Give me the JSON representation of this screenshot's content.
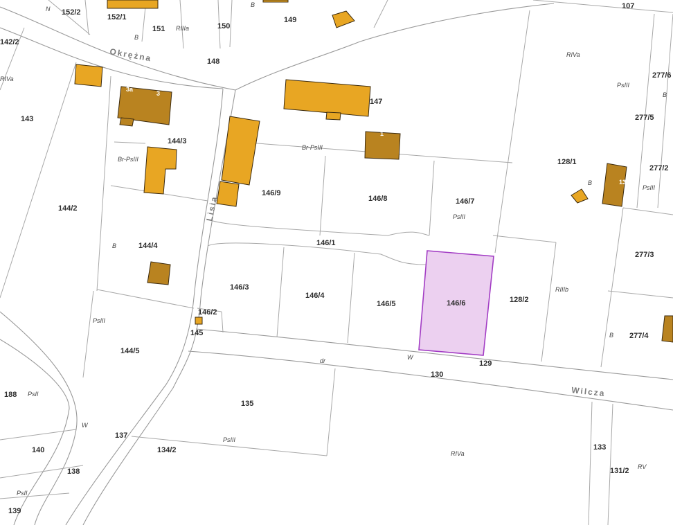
{
  "map": {
    "streets": {
      "okrezna": "Okrężna",
      "lisia": "Lisia",
      "wilcza": "Wilcza"
    },
    "parcels": {
      "p152_2": "152/2",
      "p152_1": "152/1",
      "p151": "151",
      "p150": "150",
      "p149": "149",
      "p148": "148",
      "p107": "107",
      "p142_2": "142/2",
      "p143": "143",
      "p147": "147",
      "p144_3": "144/3",
      "p144_2": "144/2",
      "p144_4": "144/4",
      "p146_9": "146/9",
      "p146_8": "146/8",
      "p146_7": "146/7",
      "p146_1": "146/1",
      "p146_3": "146/3",
      "p146_4": "146/4",
      "p146_5": "146/5",
      "p146_6": "146/6",
      "p146_2": "146/2",
      "p145": "145",
      "p144_5": "144/5",
      "p128_1": "128/1",
      "p128_2": "128/2",
      "p129": "129",
      "p130": "130",
      "p135": "135",
      "p137": "137",
      "p134_2": "134/2",
      "p188": "188",
      "p140": "140",
      "p138": "138",
      "p139": "139",
      "p133": "133",
      "p131_2": "131/2",
      "p277_6": "277/6",
      "p277_5": "277/5",
      "p277_2": "277/2",
      "p277_3": "277/3",
      "p277_4": "277/4"
    },
    "landuse": {
      "n": "N",
      "b_top": "B",
      "b_151": "B",
      "riiia": "RIIIa",
      "riva_top": "RIVa",
      "riva_left": "RIVa",
      "psiii_128": "PsIII",
      "b_277": "B",
      "brpsiii_147": "Br-PsIII",
      "brpsiii_144": "Br-PsIII",
      "b_128": "B",
      "psiii_277": "PsIII",
      "psiii_146_7": "PsIII",
      "b_144_4": "B",
      "riiib": "RIIIb",
      "psiii_144_5": "PsIII",
      "b_277_4": "B",
      "dr": "dr",
      "w_road": "W",
      "psii_188": "PsII",
      "w_left": "W",
      "psiii_134": "PsIII",
      "riva_bottom": "RIVa",
      "rv": "RV",
      "psii_139": "PsII"
    },
    "house_numbers": {
      "h3a": "3a",
      "h3": "3",
      "h1": "1",
      "h13": "13"
    },
    "selected_parcel": "146/6",
    "colors": {
      "building": "#e8a623",
      "building_dark": "#b98320",
      "selected_fill": "#ecd0f0",
      "selected_stroke": "#a23cc4"
    }
  }
}
